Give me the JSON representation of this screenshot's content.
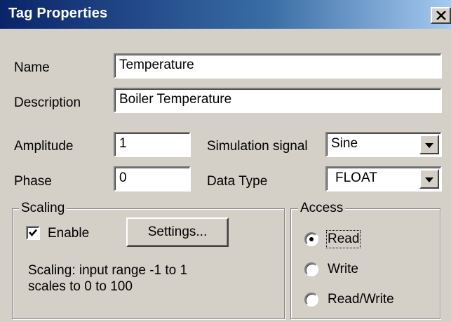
{
  "window": {
    "title": "Tag Properties",
    "close_label": "X"
  },
  "form": {
    "name_label": "Name",
    "name_value": "Temperature",
    "description_label": "Description",
    "description_value": "Boiler Temperature",
    "amplitude_label": "Amplitude",
    "amplitude_value": "1",
    "phase_label": "Phase",
    "phase_value": "0",
    "simulation_signal_label": "Simulation signal",
    "simulation_signal_value": "Sine",
    "data_type_label": "Data Type",
    "data_type_value": "FLOAT"
  },
  "scaling": {
    "legend": "Scaling",
    "enable_label": "Enable",
    "enable_checked": true,
    "settings_button_label": "Settings...",
    "info_line1": "Scaling: input range -1 to 1",
    "info_line2": "scales to 0 to 100"
  },
  "access": {
    "legend": "Access",
    "options": [
      {
        "label": "Read",
        "selected": true
      },
      {
        "label": "Write",
        "selected": false
      },
      {
        "label": "Read/Write",
        "selected": false
      }
    ]
  },
  "colors": {
    "titlebar_start": "#0a246a",
    "titlebar_end": "#a6caf0",
    "dialog_face": "#d4d0c8"
  },
  "icons": {
    "close": "close-icon",
    "dropdown": "chevron-down-icon",
    "check": "check-icon"
  }
}
